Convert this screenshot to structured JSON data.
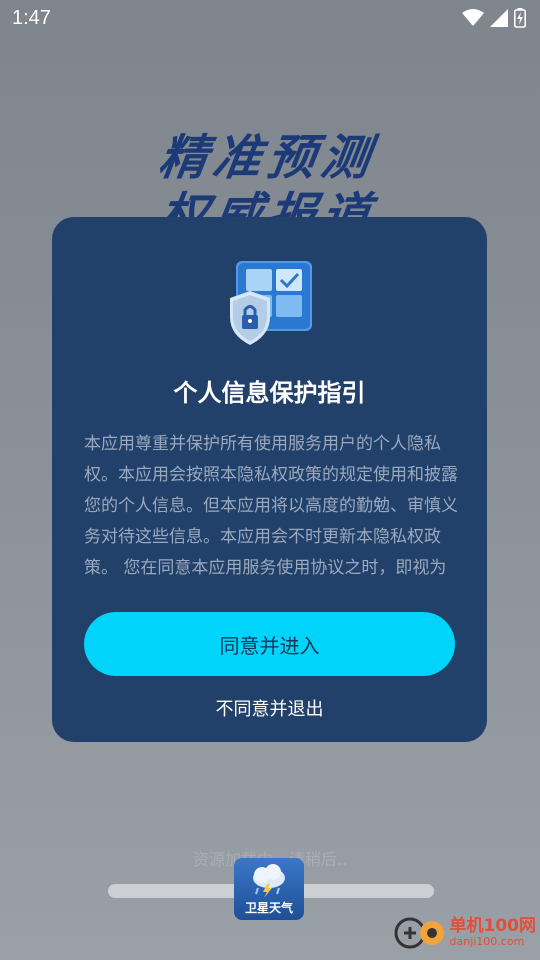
{
  "status_bar": {
    "time": "1:47",
    "icons": [
      "wifi-icon",
      "signal-icon",
      "battery-charging-icon"
    ]
  },
  "splash": {
    "slogan_line1": "精准预测",
    "slogan_line2": "权威报道",
    "loading_text": "资源加载中，请稍后..",
    "progress": 1.0,
    "app_logo_label": "卫星天气"
  },
  "dialog": {
    "icon": "privacy-shield-icon",
    "title": "个人信息保护指引",
    "body": "本应用尊重并保护所有使用服务用户的个人隐私权。本应用会按照本隐私权政策的规定使用和披露您的个人信息。但本应用将以高度的勤勉、审慎义务对待这些信息。本应用会不时更新本隐私权政策。 您在同意本应用服务使用协议之时，即视为您已经同意本隐私权政策全部内容。",
    "agree_label": "同意并进入",
    "disagree_label": "不同意并退出"
  },
  "watermark": {
    "name": "单机100网",
    "url": "danji100.com"
  },
  "colors": {
    "dialog_bg": "#21406a",
    "agree_button": "#00d4fb",
    "slogan": "#1d3a78"
  }
}
